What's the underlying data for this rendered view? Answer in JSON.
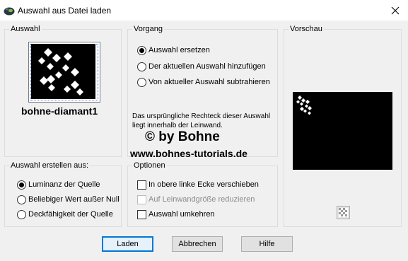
{
  "window": {
    "title": "Auswahl aus Datei laden",
    "close_glyph": "✕"
  },
  "auswahl": {
    "label": "Auswahl",
    "shape_name": "bohne-diamant1"
  },
  "vorgang": {
    "label": "Vorgang",
    "options": [
      "Auswahl ersetzen",
      "Der aktuellen Auswahl hinzufügen",
      "Von aktueller Auswahl subtrahieren"
    ],
    "selected": 0,
    "note": "Das ursprüngliche Rechteck dieser Auswahl liegt innerhalb der Leinwand."
  },
  "watermark": {
    "line1": "© by Bohne",
    "line2": "www.bohnes-tutorials.de"
  },
  "vorschau": {
    "label": "Vorschau"
  },
  "erstellen": {
    "label": "Auswahl erstellen aus:",
    "options": [
      "Luminanz der Quelle",
      "Beliebiger Wert außer Null",
      "Deckfähigkeit der Quelle"
    ],
    "selected": 0
  },
  "optionen": {
    "label": "Optionen",
    "items": [
      {
        "label": "In obere linke Ecke verschieben",
        "checked": false,
        "disabled": false
      },
      {
        "label": "Auf Leinwandgröße reduzieren",
        "checked": false,
        "disabled": true
      },
      {
        "label": "Auswahl umkehren",
        "checked": false,
        "disabled": false
      }
    ]
  },
  "buttons": {
    "load": "Laden",
    "cancel": "Abbrechen",
    "help": "Hilfe"
  },
  "icons": [
    "app-icon",
    "close-icon",
    "diamond-shape-icon",
    "checkerboard-icon"
  ]
}
